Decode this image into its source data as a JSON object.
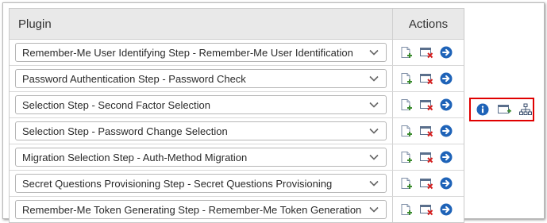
{
  "table": {
    "header_plugin": "Plugin",
    "header_actions": "Actions",
    "rows": [
      {
        "selected": "Remember-Me User Identifying Step - Remember-Me User Identification"
      },
      {
        "selected": "Password Authentication Step - Password Check"
      },
      {
        "selected": "Selection Step - Second Factor Selection"
      },
      {
        "selected": "Selection Step - Password Change Selection"
      },
      {
        "selected": "Migration Selection Step - Auth-Method Migration"
      },
      {
        "selected": "Secret Questions Provisioning Step - Secret Questions Provisioning"
      },
      {
        "selected": "Remember-Me Token Generating Step - Remember-Me Token Generation"
      }
    ]
  },
  "row_actions": [
    "add-after-icon",
    "remove-icon",
    "go-arrow-icon"
  ],
  "side_panel_icons": [
    "info-icon",
    "add-window-icon",
    "hierarchy-icon"
  ],
  "colors": {
    "header_bg": "#e9e9e9",
    "highlight_border": "#e00000",
    "arrow_blue": "#1e63b8",
    "remove_red": "#d42020",
    "add_green": "#3a8a2e"
  }
}
